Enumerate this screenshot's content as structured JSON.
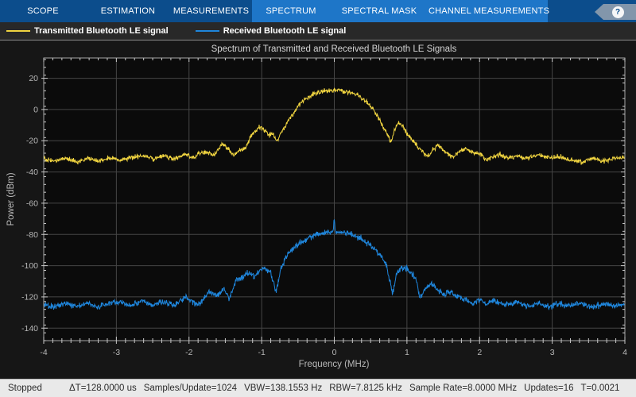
{
  "toolbar": {
    "tabs": [
      {
        "label": "SCOPE",
        "active": false
      },
      {
        "label": "ESTIMATION",
        "active": false
      },
      {
        "label": "MEASUREMENTS",
        "active": false
      },
      {
        "label": "SPECTRUM",
        "active": true
      },
      {
        "label": "SPECTRAL MASK",
        "active": false
      },
      {
        "label": "CHANNEL MEASUREMENTS",
        "active": false
      }
    ],
    "help_icon": "?"
  },
  "legend": {
    "items": [
      {
        "label": "Transmitted Bluetooth LE signal",
        "color": "#f0d440"
      },
      {
        "label": "Received Bluetooth LE signal",
        "color": "#1f86dc"
      }
    ]
  },
  "colors": {
    "toolbar_dark": "#0c4d8c",
    "toolbar_light": "#1e76c8",
    "plot_background": "#0b0b0b",
    "grid": "#464646",
    "axis_box": "#a8a8a8",
    "tick": "#c8c8c8",
    "tick_label": "#b9b9b9",
    "title": "#d4d4d4"
  },
  "chart_data": {
    "type": "line",
    "title": "Spectrum of Transmitted and Received Bluetooth LE Signals",
    "xlabel": "Frequency (MHz)",
    "ylabel": "Power (dBm)",
    "xlim": [
      -4,
      4
    ],
    "ylim": [
      -148,
      33
    ],
    "xticks": [
      -4,
      -3,
      -2,
      -1,
      0,
      1,
      2,
      3,
      4
    ],
    "yticks": [
      20,
      0,
      -20,
      -40,
      -60,
      -80,
      -100,
      -120,
      -140
    ],
    "x_minor_step": 0.125,
    "y_minor_step": 5,
    "grid": true,
    "legend_position": "top-strip",
    "series": [
      {
        "name": "Transmitted Bluetooth LE signal",
        "color": "#f0d440",
        "noise_db": 1.4,
        "peak_dbm": 12.5,
        "noise_floor_dbm": -31,
        "envelope": [
          [
            -4.0,
            -31.5
          ],
          [
            -3.85,
            -33
          ],
          [
            -3.7,
            -31
          ],
          [
            -3.55,
            -33.5
          ],
          [
            -3.4,
            -31.5
          ],
          [
            -3.25,
            -33
          ],
          [
            -3.1,
            -30.5
          ],
          [
            -2.95,
            -32.5
          ],
          [
            -2.8,
            -30.5
          ],
          [
            -2.65,
            -29.5
          ],
          [
            -2.5,
            -31.5
          ],
          [
            -2.35,
            -29.5
          ],
          [
            -2.2,
            -31.5
          ],
          [
            -2.05,
            -28.5
          ],
          [
            -1.95,
            -31
          ],
          [
            -1.85,
            -28
          ],
          [
            -1.75,
            -27.5
          ],
          [
            -1.65,
            -29.5
          ],
          [
            -1.55,
            -22
          ],
          [
            -1.45,
            -25.5
          ],
          [
            -1.38,
            -29.5
          ],
          [
            -1.3,
            -26
          ],
          [
            -1.22,
            -24.5
          ],
          [
            -1.12,
            -14.5
          ],
          [
            -1.02,
            -11.5
          ],
          [
            -0.95,
            -13.5
          ],
          [
            -0.9,
            -16.5
          ],
          [
            -0.85,
            -15
          ],
          [
            -0.8,
            -21
          ],
          [
            -0.74,
            -16
          ],
          [
            -0.68,
            -11
          ],
          [
            -0.62,
            -6
          ],
          [
            -0.55,
            -1.5
          ],
          [
            -0.48,
            3
          ],
          [
            -0.4,
            6.5
          ],
          [
            -0.32,
            9
          ],
          [
            -0.24,
            10.5
          ],
          [
            -0.16,
            11.5
          ],
          [
            -0.08,
            12
          ],
          [
            0,
            12.5
          ],
          [
            0.08,
            12
          ],
          [
            0.16,
            11
          ],
          [
            0.24,
            10.5
          ],
          [
            0.32,
            9.5
          ],
          [
            0.4,
            7
          ],
          [
            0.48,
            3.5
          ],
          [
            0.55,
            -1
          ],
          [
            0.62,
            -6.5
          ],
          [
            0.68,
            -11.5
          ],
          [
            0.74,
            -16.5
          ],
          [
            0.78,
            -21.5
          ],
          [
            0.84,
            -12
          ],
          [
            0.88,
            -8.5
          ],
          [
            0.94,
            -11
          ],
          [
            1.0,
            -15.5
          ],
          [
            1.08,
            -20
          ],
          [
            1.16,
            -24.5
          ],
          [
            1.28,
            -30
          ],
          [
            1.36,
            -26
          ],
          [
            1.43,
            -22.5
          ],
          [
            1.52,
            -27
          ],
          [
            1.63,
            -30.5
          ],
          [
            1.72,
            -27
          ],
          [
            1.81,
            -25
          ],
          [
            1.9,
            -27.5
          ],
          [
            2.0,
            -28.5
          ],
          [
            2.1,
            -32
          ],
          [
            2.2,
            -30
          ],
          [
            2.28,
            -28.5
          ],
          [
            2.38,
            -31
          ],
          [
            2.5,
            -30
          ],
          [
            2.62,
            -31.5
          ],
          [
            2.75,
            -29.5
          ],
          [
            2.85,
            -29
          ],
          [
            2.95,
            -31
          ],
          [
            3.1,
            -30
          ],
          [
            3.25,
            -32.5
          ],
          [
            3.4,
            -33.5
          ],
          [
            3.55,
            -31
          ],
          [
            3.7,
            -33
          ],
          [
            3.85,
            -31.5
          ],
          [
            4.0,
            -30.5
          ]
        ]
      },
      {
        "name": "Received Bluetooth LE signal",
        "color": "#1f86dc",
        "noise_db": 1.8,
        "peak_dbm": -70,
        "noise_floor_dbm": -125,
        "envelope": [
          [
            -4.0,
            -125
          ],
          [
            -3.85,
            -126.5
          ],
          [
            -3.7,
            -124.5
          ],
          [
            -3.55,
            -126
          ],
          [
            -3.4,
            -124
          ],
          [
            -3.25,
            -126.5
          ],
          [
            -3.1,
            -124
          ],
          [
            -2.95,
            -123.5
          ],
          [
            -2.8,
            -126
          ],
          [
            -2.65,
            -122.5
          ],
          [
            -2.5,
            -125.5
          ],
          [
            -2.35,
            -123
          ],
          [
            -2.2,
            -125.5
          ],
          [
            -2.05,
            -120
          ],
          [
            -1.95,
            -123.5
          ],
          [
            -1.85,
            -125
          ],
          [
            -1.72,
            -116.5
          ],
          [
            -1.62,
            -119
          ],
          [
            -1.52,
            -114.5
          ],
          [
            -1.45,
            -121.5
          ],
          [
            -1.35,
            -109
          ],
          [
            -1.25,
            -106.5
          ],
          [
            -1.17,
            -104.5
          ],
          [
            -1.1,
            -107
          ],
          [
            -1.02,
            -102.5
          ],
          [
            -0.95,
            -101.5
          ],
          [
            -0.88,
            -104.5
          ],
          [
            -0.8,
            -116.5
          ],
          [
            -0.74,
            -103
          ],
          [
            -0.68,
            -95.5
          ],
          [
            -0.6,
            -90.5
          ],
          [
            -0.52,
            -87
          ],
          [
            -0.44,
            -84.5
          ],
          [
            -0.36,
            -82.5
          ],
          [
            -0.28,
            -80.5
          ],
          [
            -0.2,
            -79.5
          ],
          [
            -0.12,
            -79
          ],
          [
            -0.04,
            -78.5
          ],
          [
            -0.015,
            -78.5
          ],
          [
            0,
            -70
          ],
          [
            0.015,
            -78.5
          ],
          [
            0.08,
            -78.5
          ],
          [
            0.16,
            -79
          ],
          [
            0.24,
            -80
          ],
          [
            0.32,
            -81.5
          ],
          [
            0.4,
            -83.5
          ],
          [
            0.48,
            -86.5
          ],
          [
            0.56,
            -89.5
          ],
          [
            0.64,
            -93.5
          ],
          [
            0.72,
            -100
          ],
          [
            0.8,
            -118
          ],
          [
            0.86,
            -104.5
          ],
          [
            0.92,
            -101.5
          ],
          [
            1.0,
            -102.5
          ],
          [
            1.06,
            -104.5
          ],
          [
            1.12,
            -108
          ],
          [
            1.18,
            -121
          ],
          [
            1.26,
            -114.5
          ],
          [
            1.34,
            -111.5
          ],
          [
            1.42,
            -115.5
          ],
          [
            1.5,
            -118.5
          ],
          [
            1.58,
            -116.5
          ],
          [
            1.68,
            -119.5
          ],
          [
            1.78,
            -121.5
          ],
          [
            1.9,
            -124
          ],
          [
            2.0,
            -121.5
          ],
          [
            2.1,
            -124.5
          ],
          [
            2.2,
            -122
          ],
          [
            2.35,
            -125.5
          ],
          [
            2.5,
            -123
          ],
          [
            2.65,
            -126
          ],
          [
            2.8,
            -124
          ],
          [
            2.95,
            -126.5
          ],
          [
            3.1,
            -124.5
          ],
          [
            3.25,
            -126
          ],
          [
            3.4,
            -124
          ],
          [
            3.55,
            -126.5
          ],
          [
            3.7,
            -124.5
          ],
          [
            3.85,
            -126
          ],
          [
            4.0,
            -124.5
          ]
        ]
      }
    ]
  },
  "status_bar": {
    "state": "Stopped",
    "stats": [
      "ΔT=128.0000 us",
      "Samples/Update=1024",
      "VBW=138.1553 Hz",
      "RBW=7.8125 kHz",
      "Sample Rate=8.0000 MHz",
      "Updates=16",
      "T=0.0021"
    ]
  }
}
